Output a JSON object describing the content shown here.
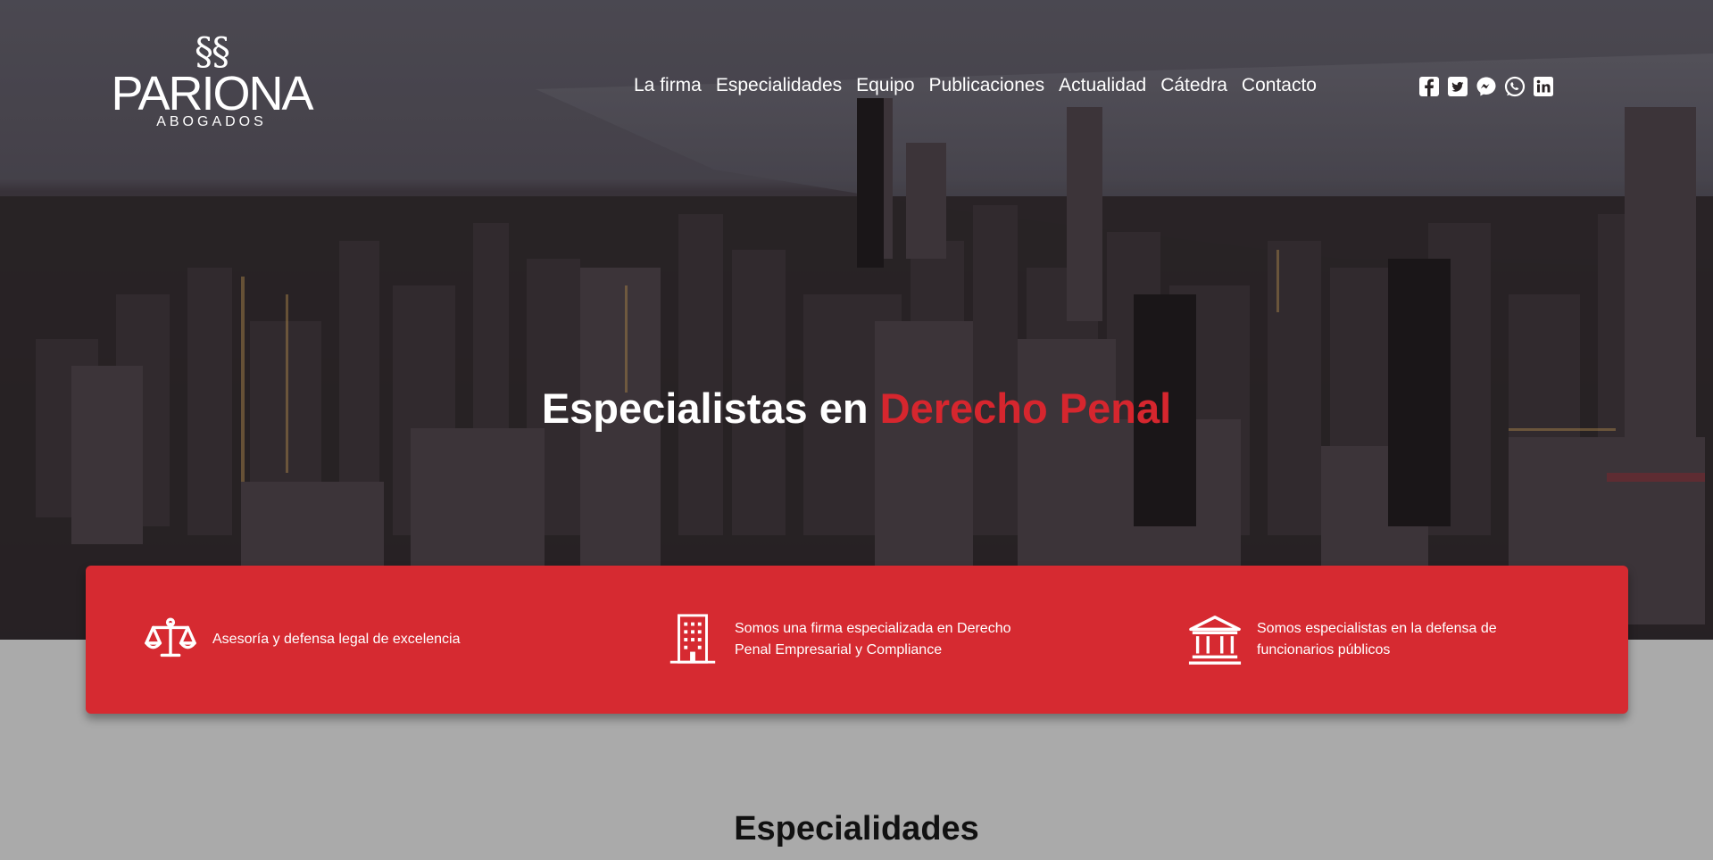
{
  "brand": {
    "mark": "§§",
    "name": "PARIONA",
    "subtitle": "ABOGADOS"
  },
  "nav": {
    "items": [
      {
        "label": "La firma"
      },
      {
        "label": "Especialidades"
      },
      {
        "label": "Equipo"
      },
      {
        "label": "Publicaciones"
      },
      {
        "label": "Actualidad"
      },
      {
        "label": "Cátedra"
      },
      {
        "label": "Contacto"
      }
    ]
  },
  "social": [
    "facebook-icon",
    "twitter-icon",
    "messenger-icon",
    "whatsapp-icon",
    "linkedin-icon"
  ],
  "hero": {
    "headline_main": "Especialistas en ",
    "headline_accent": "Derecho Penal"
  },
  "features": [
    {
      "icon": "scales-icon",
      "text": "Asesoría y defensa legal de excelencia"
    },
    {
      "icon": "building-icon",
      "text": "Somos una firma especializada en Derecho Penal Empresarial y Compliance"
    },
    {
      "icon": "courthouse-icon",
      "text": "Somos especialistas en la defensa de funcionarios públicos"
    }
  ],
  "sections": {
    "specialties_title": "Especialidades"
  },
  "colors": {
    "accent": "#d62a31",
    "background": "#aaaaaa"
  }
}
